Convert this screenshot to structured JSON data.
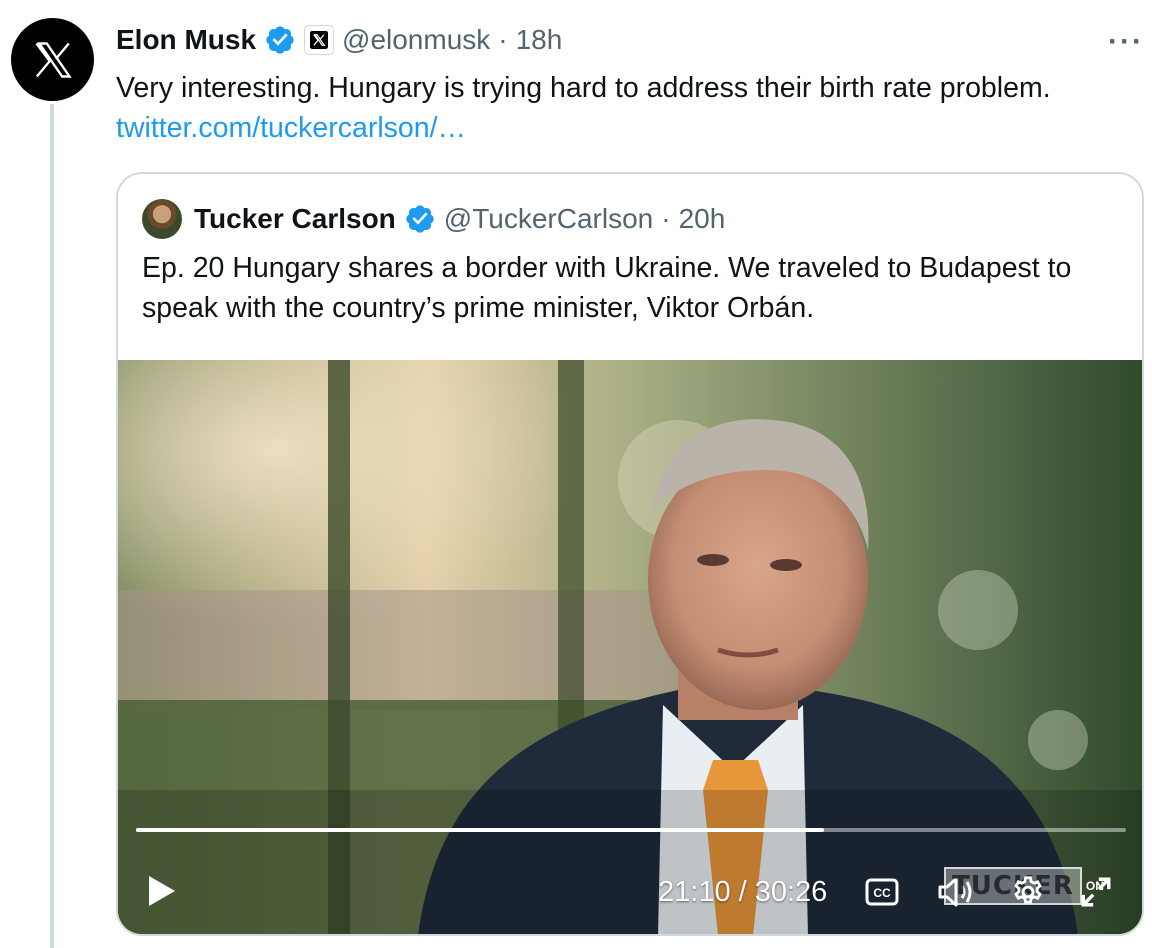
{
  "tweet": {
    "author_name": "Elon Musk",
    "author_handle": "@elonmusk",
    "separator": "·",
    "time_ago": "18h",
    "more_label": "···",
    "text": "Very interesting. Hungary is trying hard to address their birth rate problem.",
    "link_text": "twitter.com/tuckercarlson/…",
    "avatar_icon": "x-logo-icon",
    "verified_color": "#1d9bf0"
  },
  "quoted_tweet": {
    "author_name": "Tucker Carlson",
    "author_handle": "@TuckerCarlson",
    "separator": "·",
    "time_ago": "20h",
    "text": "Ep. 20  Hungary shares a border with Ukraine. We traveled to Budapest to speak with the country’s prime minister, Viktor Orbán."
  },
  "video": {
    "timecode": "21:10 / 30:26",
    "progress": 0.695,
    "watermark_text": "TUCKER",
    "watermark_on": "ON",
    "controls": [
      "play-icon",
      "closed-captions-icon",
      "volume-icon",
      "settings-icon",
      "fullscreen-icon"
    ]
  },
  "colors": {
    "link": "#1d9bf0",
    "secondary_text": "#536471",
    "border": "#cfd9de"
  }
}
